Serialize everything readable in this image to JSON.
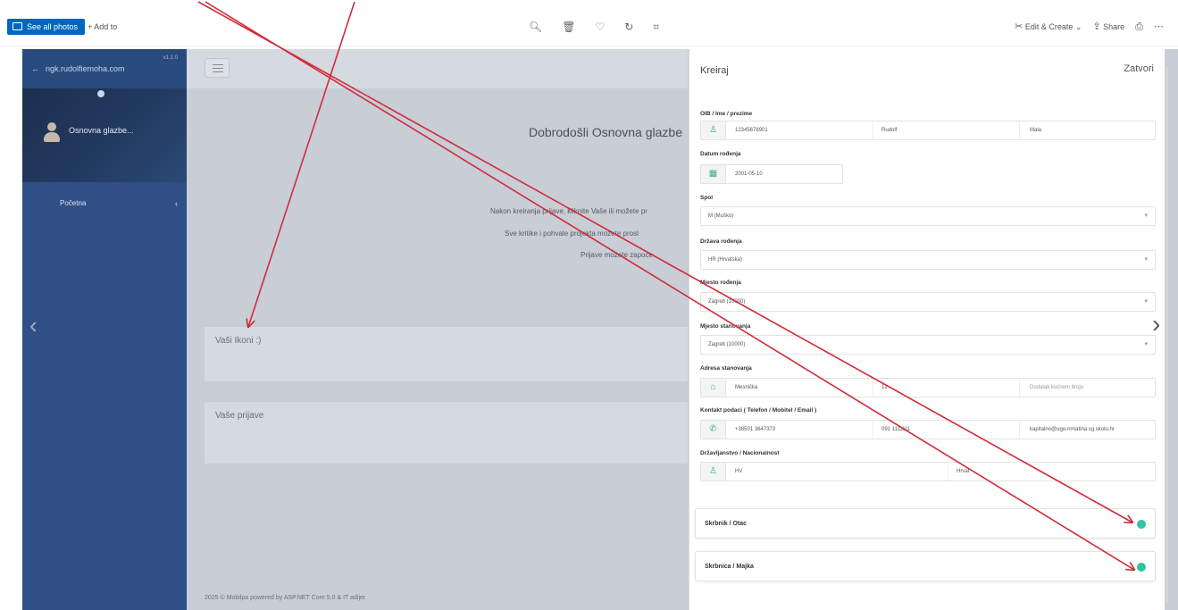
{
  "toolbar": {
    "see_all_label": "See all photos",
    "add_label": "+ Add to",
    "center_icons": [
      "zoom-icon",
      "delete-icon",
      "favorite-icon",
      "rotate-icon",
      "crop-icon"
    ],
    "edit_create_label": "Edit & Create",
    "share_label": "Share"
  },
  "sidebar": {
    "brand": "ngk.rudolfiemoha.com",
    "version": "v1.1.0",
    "user_name": "Osnovna glazbe...",
    "items": [
      {
        "label": "Početna"
      }
    ]
  },
  "main": {
    "welcome": "Dobrodošli Osnovna glazbe",
    "info_lines": [
      "Nakon kreiranja prijave, kliknite Vaše ili možete pr",
      "Sve kritike i pohvale projekta možete prosl",
      "Prijave možete započe"
    ],
    "cards": [
      {
        "title": "Vaši Ikoni :)"
      },
      {
        "title": "Vaše prijave"
      }
    ],
    "footer": "2025 © Mobilpa powered by ASP.NET Core 5.0 & IT adijer"
  },
  "panel": {
    "title": "Kreiraj",
    "close_label": "Zatvori",
    "oib_label": "OIB / Ime / prezime",
    "oib_value": "12345678901",
    "first_name": "Rudolf",
    "last_name": "Mala",
    "dob_label": "Datum rođenja",
    "dob_value": "2001-05-10",
    "gender_label": "Spol",
    "gender_value": "M (Muško)",
    "country_label": "Država rođenja",
    "country_value": "HR (Hrvatska)",
    "birthplace_label": "Mjesto rođenja",
    "birthplace_value": "Zagreb (10000)",
    "residence_label": "Mjesto stanovanja",
    "residence_value": "Zagreb (10000)",
    "address_label": "Adresa stanovanja",
    "street": "Mesnička",
    "house_no": "12",
    "address_extra": "Dodatak kućnom broju",
    "contact_label": "Kontakt podaci ( Telefon / Mobitel / Email )",
    "phone": "+38501 3647373",
    "mobile": "091 1111111",
    "email": "kapitalno@ugo-rrmatina.sg.skolo.hr",
    "citizenship_label": "Državljanstvo / Nacionalnost",
    "citizenship_value": "HV",
    "nationality_value": "Hrvat",
    "guardian1_label": "Skrbnik / Otac",
    "guardian2_label": "Skrbnica / Majka",
    "accent": "#2ec4a6"
  },
  "annotation": {
    "color": "#d22b3a"
  }
}
